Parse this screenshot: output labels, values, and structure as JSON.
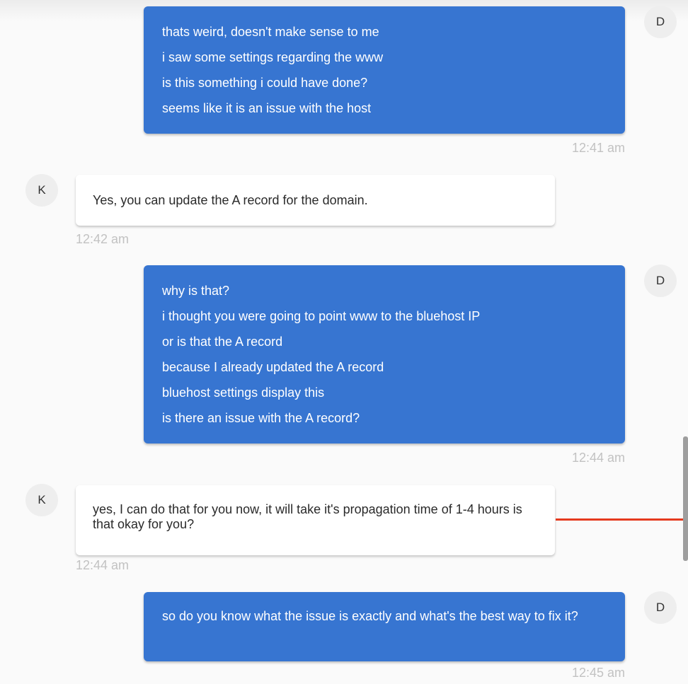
{
  "messages": [
    {
      "sender": "user",
      "avatar": "D",
      "lines": [
        "thats weird, doesn't make sense to me",
        "i saw some settings regarding the www",
        "is this something i could have done?",
        "seems like it is an issue with the host"
      ],
      "time": "12:41 am"
    },
    {
      "sender": "agent",
      "avatar": "K",
      "lines": [
        "Yes, you can update the A record for the domain."
      ],
      "time": "12:42 am"
    },
    {
      "sender": "user",
      "avatar": "D",
      "lines": [
        "why is that?",
        "i thought you were going to point www to the bluehost IP",
        "or is that the A record",
        "because I already updated the A record",
        "bluehost settings display this",
        "is there an issue with the A record?"
      ],
      "time": "12:44 am"
    },
    {
      "sender": "agent",
      "avatar": "K",
      "lines": [
        "yes, I can do that for you now, it will take it's propagation time of 1-4 hours is that okay for you?"
      ],
      "time": "12:44 am"
    },
    {
      "sender": "user",
      "avatar": "D",
      "lines": [
        "so do you know what the issue is exactly and what's the best way to fix it?"
      ],
      "time": "12:45 am"
    }
  ],
  "colors": {
    "user_bubble": "#3775d1",
    "agent_bubble": "#ffffff",
    "background": "#fafafa",
    "timestamp": "#c2c2c2",
    "annotation": "#e53a1e"
  }
}
